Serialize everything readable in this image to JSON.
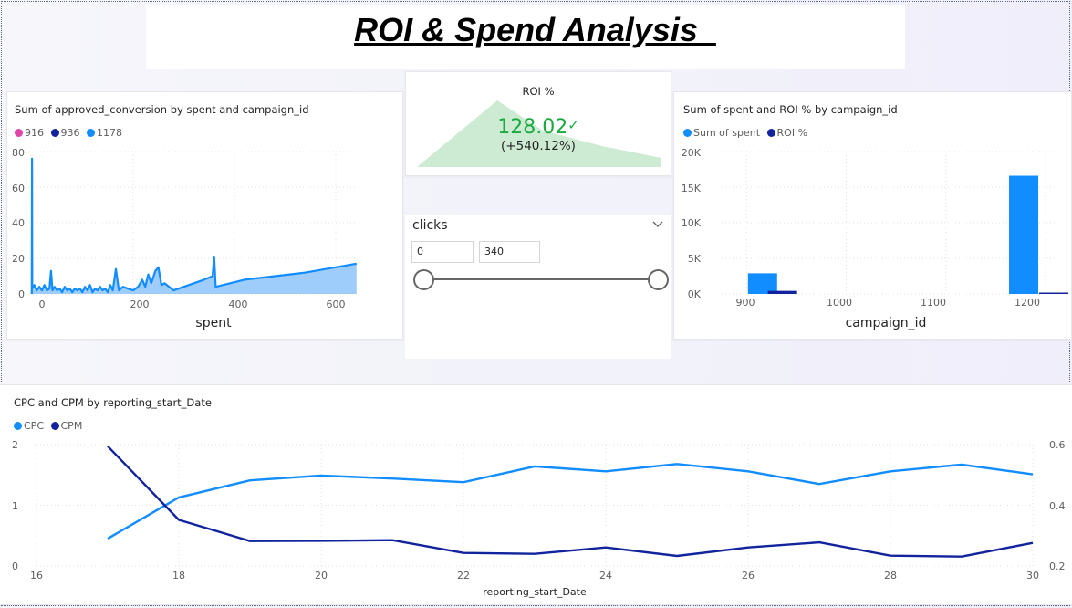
{
  "report_title": "ROI & Spend Analysis  ",
  "colors": {
    "pink": "#e044a7",
    "navy": "#12239e",
    "blue": "#118dff",
    "kpi_green": "#1aab40",
    "kpi_area": "#cdebd3",
    "area_fill": "#9fcdfb"
  },
  "chart1": {
    "title": "Sum of approved_conversion by spent and campaign_id",
    "legend": [
      "916",
      "936",
      "1178"
    ],
    "xlabel": "spent",
    "yticks": [
      "0",
      "20",
      "40",
      "60",
      "80"
    ],
    "xticks": [
      "0",
      "200",
      "400",
      "600"
    ]
  },
  "kpi": {
    "title": "ROI %",
    "value": "128.02",
    "check_icon": "check-icon",
    "change": "(+540.12%)"
  },
  "slicer": {
    "title": "clicks",
    "chevron_icon": "chevron-down-icon",
    "min_value": "0",
    "max_value": "340",
    "range_min": 0,
    "range_max": 340
  },
  "chart2": {
    "title": "Sum of spent and ROI % by campaign_id",
    "legend": [
      "Sum of spent",
      "ROI %"
    ],
    "xlabel": "campaign_id",
    "yticks": [
      "0K",
      "5K",
      "10K",
      "15K",
      "20K"
    ],
    "xticks": [
      "900",
      "1000",
      "1100",
      "1200"
    ]
  },
  "chart3": {
    "title": "CPC and CPM by reporting_start_Date",
    "legend": [
      "CPC",
      "CPM"
    ],
    "xlabel": "reporting_start_Date",
    "yticks_left": [
      "0",
      "1",
      "2"
    ],
    "yticks_right": [
      "0.2",
      "0.4",
      "0.6"
    ],
    "xticks": [
      "16",
      "18",
      "20",
      "22",
      "24",
      "26",
      "28",
      "30"
    ]
  },
  "chart_data": [
    {
      "type": "area",
      "title": "Sum of approved_conversion by spent and campaign_id",
      "xlabel": "spent",
      "ylabel": "",
      "xlim": [
        -5,
        645
      ],
      "ylim": [
        0,
        80
      ],
      "series": [
        {
          "name": "1178",
          "points": [
            [
              0,
              0
            ],
            [
              0.5,
              76
            ],
            [
              1,
              3
            ],
            [
              5,
              5
            ],
            [
              10,
              2
            ],
            [
              15,
              4
            ],
            [
              20,
              2
            ],
            [
              25,
              5
            ],
            [
              30,
              2
            ],
            [
              35,
              3
            ],
            [
              38,
              13
            ],
            [
              41,
              2
            ],
            [
              45,
              4
            ],
            [
              50,
              2
            ],
            [
              55,
              3
            ],
            [
              60,
              1
            ],
            [
              65,
              4
            ],
            [
              70,
              2
            ],
            [
              75,
              3
            ],
            [
              80,
              1
            ],
            [
              85,
              3
            ],
            [
              90,
              2
            ],
            [
              95,
              3
            ],
            [
              100,
              1
            ],
            [
              105,
              4
            ],
            [
              110,
              2
            ],
            [
              115,
              5
            ],
            [
              120,
              1
            ],
            [
              125,
              3
            ],
            [
              130,
              2
            ],
            [
              135,
              4
            ],
            [
              140,
              2
            ],
            [
              145,
              3
            ],
            [
              150,
              1
            ],
            [
              155,
              5
            ],
            [
              160,
              2
            ],
            [
              166,
              14
            ],
            [
              172,
              2
            ],
            [
              180,
              4
            ],
            [
              190,
              3
            ],
            [
              200,
              2
            ],
            [
              210,
              4
            ],
            [
              218,
              8
            ],
            [
              224,
              4
            ],
            [
              230,
              11
            ],
            [
              236,
              6
            ],
            [
              244,
              13
            ],
            [
              250,
              15
            ],
            [
              256,
              5
            ],
            [
              262,
              6
            ],
            [
              280,
              2
            ],
            [
              300,
              4
            ],
            [
              320,
              6
            ],
            [
              340,
              8
            ],
            [
              357,
              10
            ],
            [
              360,
              21
            ],
            [
              363,
              4
            ],
            [
              420,
              8
            ],
            [
              480,
              10
            ],
            [
              540,
              12
            ],
            [
              600,
              15
            ],
            [
              641,
              17
            ]
          ]
        },
        {
          "name": "936",
          "points": []
        },
        {
          "name": "916",
          "points": []
        }
      ]
    },
    {
      "type": "bar",
      "title": "Sum of spent and ROI % by campaign_id",
      "xlabel": "campaign_id",
      "ylim": [
        0,
        20000
      ],
      "xlim": [
        875,
        1210
      ],
      "bars": [
        {
          "campaign_id": 916,
          "series": "Sum of spent",
          "value": 2900
        },
        {
          "campaign_id": 936,
          "series": "Sum of spent",
          "value": 430
        },
        {
          "campaign_id": 1178,
          "series": "Sum of spent",
          "value": 16600
        },
        {
          "campaign_id": 1178,
          "series": "ROI %",
          "value": 70
        }
      ]
    },
    {
      "type": "line",
      "title": "CPC and CPM by reporting_start_Date",
      "xlabel": "reporting_start_Date",
      "x": [
        17,
        18,
        19,
        20,
        21,
        22,
        23,
        24,
        25,
        26,
        27,
        28,
        29,
        30
      ],
      "xlim": [
        16,
        30
      ],
      "ylim_left": [
        0,
        2
      ],
      "ylim_right": [
        0.2,
        0.6
      ],
      "series": [
        {
          "name": "CPC",
          "axis": "left",
          "values": [
            0.45,
            1.13,
            1.41,
            1.49,
            1.44,
            1.38,
            1.64,
            1.56,
            1.68,
            1.56,
            1.35,
            1.56,
            1.67,
            1.51
          ]
        },
        {
          "name": "CPM",
          "axis": "right",
          "values": [
            0.595,
            0.352,
            0.282,
            0.283,
            0.285,
            0.243,
            0.24,
            0.261,
            0.233,
            0.261,
            0.278,
            0.234,
            0.231,
            0.276
          ]
        }
      ]
    }
  ]
}
